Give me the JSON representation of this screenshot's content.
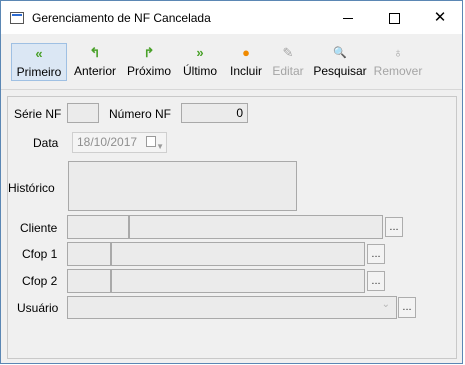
{
  "window": {
    "title": "Gerenciamento de NF Cancelada"
  },
  "toolbar": {
    "items": [
      {
        "label": "Primeiro",
        "icon": "double-left-arrow",
        "symbol": "«"
      },
      {
        "label": "Anterior",
        "icon": "undo-arrow",
        "symbol": "↰"
      },
      {
        "label": "Próximo",
        "icon": "redo-arrow",
        "symbol": "↱"
      },
      {
        "label": "Último",
        "icon": "double-right-arrow",
        "symbol": "»"
      },
      {
        "label": "Incluir",
        "icon": "insert-circle",
        "symbol": "●"
      },
      {
        "label": "Editar",
        "icon": "pencil",
        "symbol": "✎"
      },
      {
        "label": "Pesquisar",
        "icon": "search-magnifier",
        "symbol": "🔍"
      },
      {
        "label": "Remover",
        "icon": "remove",
        "symbol": "♁"
      }
    ]
  },
  "form": {
    "serie_label": "Série NF",
    "serie_value": "",
    "numero_label": "Número NF",
    "numero_value": "0",
    "data_label": "Data",
    "data_value": "18/10/2017",
    "historico_label": "Histórico",
    "historico_value": "",
    "cliente_label": "Cliente",
    "cfop1_label": "Cfop 1",
    "cfop2_label": "Cfop 2",
    "usuario_label": "Usuário",
    "ellipsis": "...",
    "dropdown_arrow": "⌄"
  },
  "colors": {
    "accent": "#2d6bd1",
    "window_bg": "#f0f0f0",
    "field_bg": "#ebebeb"
  }
}
